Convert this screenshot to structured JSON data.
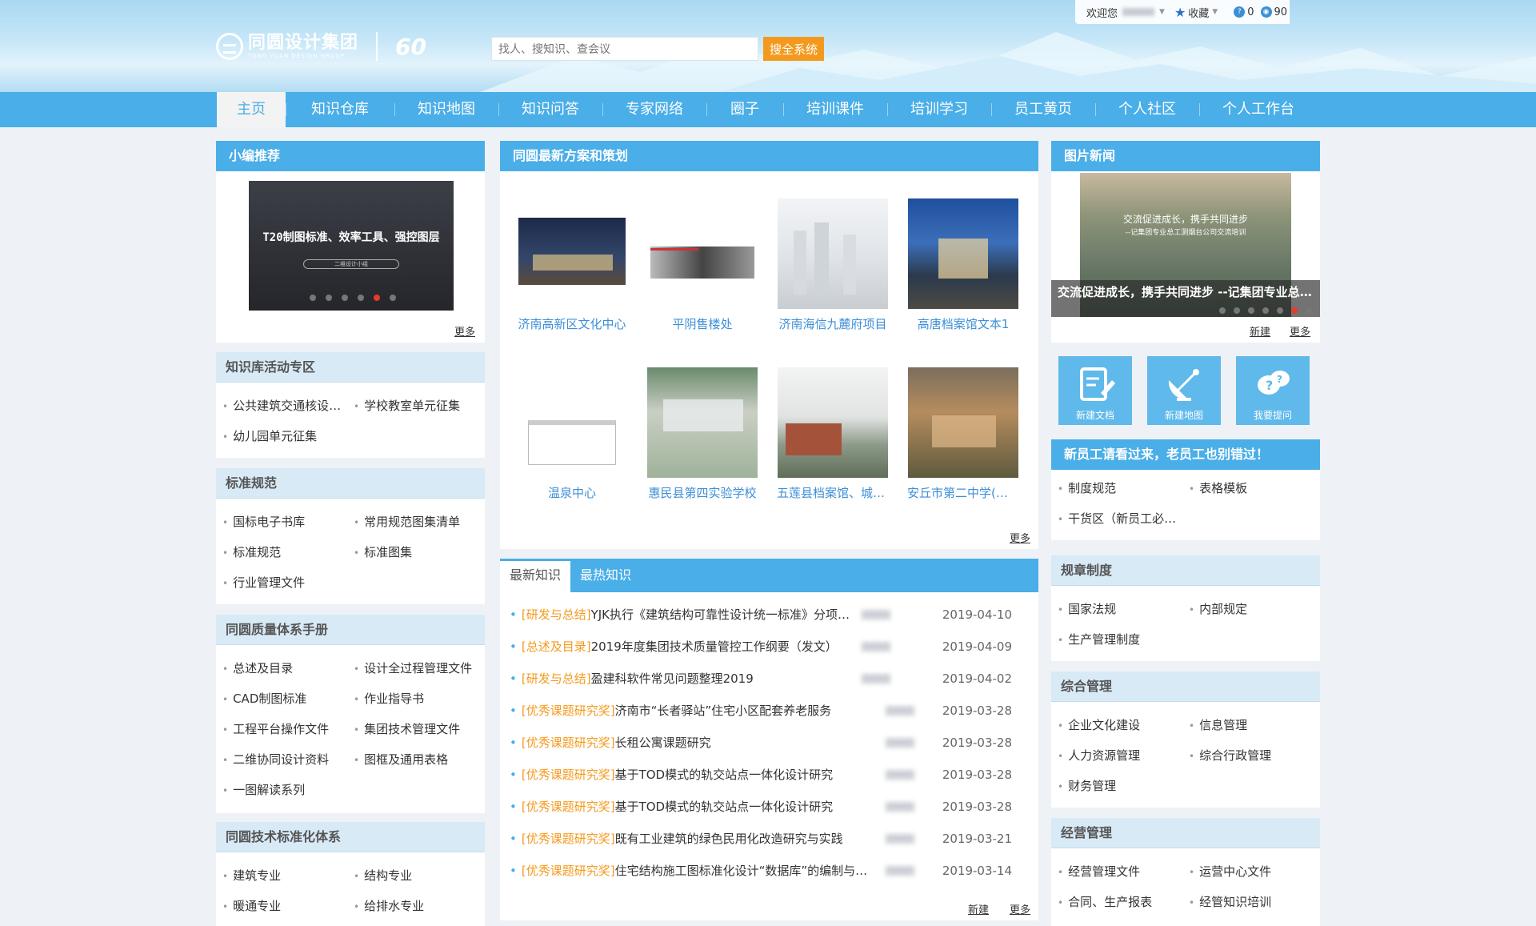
{
  "header": {
    "logo_cn": "同圆设计集团",
    "logo_en": "TONG YUAN DESIGN GROUP",
    "anniversary": "60",
    "search_placeholder": "找人、搜知识、查会议",
    "search_button": "搜全系统",
    "welcome": "欢迎您",
    "favorites": "收藏",
    "question_count": "0",
    "view_count": "90"
  },
  "nav": {
    "items": [
      "主页",
      "知识仓库",
      "知识地图",
      "知识问答",
      "专家网络",
      "圈子",
      "培训课件",
      "培训学习",
      "员工黄页",
      "个人社区",
      "个人工作台"
    ],
    "active": "主页"
  },
  "left": {
    "editor_pick": {
      "title": "小编推荐",
      "banner_text": "T20制图标准、效率工具、强控图层",
      "banner_sub": "二维设计小组",
      "more": "更多"
    },
    "sections": [
      {
        "title": "知识库活动专区",
        "items": [
          "公共建筑交通核设计征集",
          "学校教室单元征集",
          "幼儿园单元征集"
        ]
      },
      {
        "title": "标准规范",
        "items": [
          "国标电子书库",
          "常用规范图集清单",
          "标准规范",
          "标准图集",
          "行业管理文件"
        ]
      },
      {
        "title": "同圆质量体系手册",
        "items": [
          "总述及目录",
          "设计全过程管理文件",
          "CAD制图标准",
          "作业指导书",
          "工程平台操作文件",
          "集团技术管理文件",
          "二维协同设计资料",
          "图框及通用表格",
          "一图解读系列"
        ]
      },
      {
        "title": "同圆技术标准化体系",
        "items": [
          "建筑专业",
          "结构专业",
          "暖通专业",
          "给排水专业"
        ]
      }
    ]
  },
  "center": {
    "projects_title": "同圆最新方案和策划",
    "projects": [
      "济南高新区文化中心",
      "平阴售楼处",
      "济南海信九麓府项目",
      "高唐档案馆文本1",
      "温泉中心",
      "惠民县第四实验学校",
      "五莲县档案馆、城建档案馆",
      "安丘市第二中学(新校区)"
    ],
    "projects_more": "更多",
    "tabs": [
      "最新知识",
      "最热知识"
    ],
    "news": [
      {
        "cat": "[研发与总结]",
        "title": "YJK执行《建筑结构可靠性设计统一标准》分项系数调整说明",
        "date": "2019-04-10"
      },
      {
        "cat": "[总述及目录]",
        "title": "2019年度集团技术质量管控工作纲要（发文）",
        "date": "2019-04-09"
      },
      {
        "cat": "[研发与总结]",
        "title": "盈建科软件常见问题整理2019",
        "date": "2019-04-02"
      },
      {
        "cat": "[优秀课题研究奖]",
        "title": "济南市“长者驿站”住宅小区配套养老服务",
        "date": "2019-03-28"
      },
      {
        "cat": "[优秀课题研究奖]",
        "title": "长租公寓课题研究",
        "date": "2019-03-28"
      },
      {
        "cat": "[优秀课题研究奖]",
        "title": "基于TOD模式的轨交站点一体化设计研究",
        "date": "2019-03-28"
      },
      {
        "cat": "[优秀课题研究奖]",
        "title": "基于TOD模式的轨交站点一体化设计研究",
        "date": "2019-03-28"
      },
      {
        "cat": "[优秀课题研究奖]",
        "title": "既有工业建筑的绿色民用化改造研究与实践",
        "date": "2019-03-21"
      },
      {
        "cat": "[优秀课题研究奖]",
        "title": "住宅结构施工图标准化设计“数据库”的编制与应用",
        "date": "2019-03-14"
      }
    ],
    "news_new": "新建",
    "news_more": "更多"
  },
  "right": {
    "photo_news_title": "图片新闻",
    "photo_caption": "交流促进成长，携手共同进步 --记集团专业总工测赛",
    "photo_overlay_line1": "交流促进成长，携手共同进步",
    "photo_overlay_line2": "--记集团专业总工测烟台公司交流培训",
    "photo_new": "新建",
    "photo_more": "更多",
    "quick": [
      "新建文档",
      "新建地图",
      "我要提问"
    ],
    "promo": "新员工请看过来，老员工也别错过！",
    "promo_items": [
      "制度规范",
      "表格模板",
      "干货区（新员工必读）"
    ],
    "sections": [
      {
        "title": "规章制度",
        "items": [
          "国家法规",
          "内部规定",
          "生产管理制度"
        ]
      },
      {
        "title": "综合管理",
        "items": [
          "企业文化建设",
          "信息管理",
          "人力资源管理",
          "综合行政管理",
          "财务管理"
        ]
      },
      {
        "title": "经营管理",
        "items": [
          "经营管理文件",
          "运营中心文件",
          "合同、生产报表",
          "经管知识培训"
        ]
      }
    ]
  },
  "colors": {
    "primary": "#4aaee8",
    "accent": "#f39a1e",
    "link": "#3d8fd6"
  }
}
